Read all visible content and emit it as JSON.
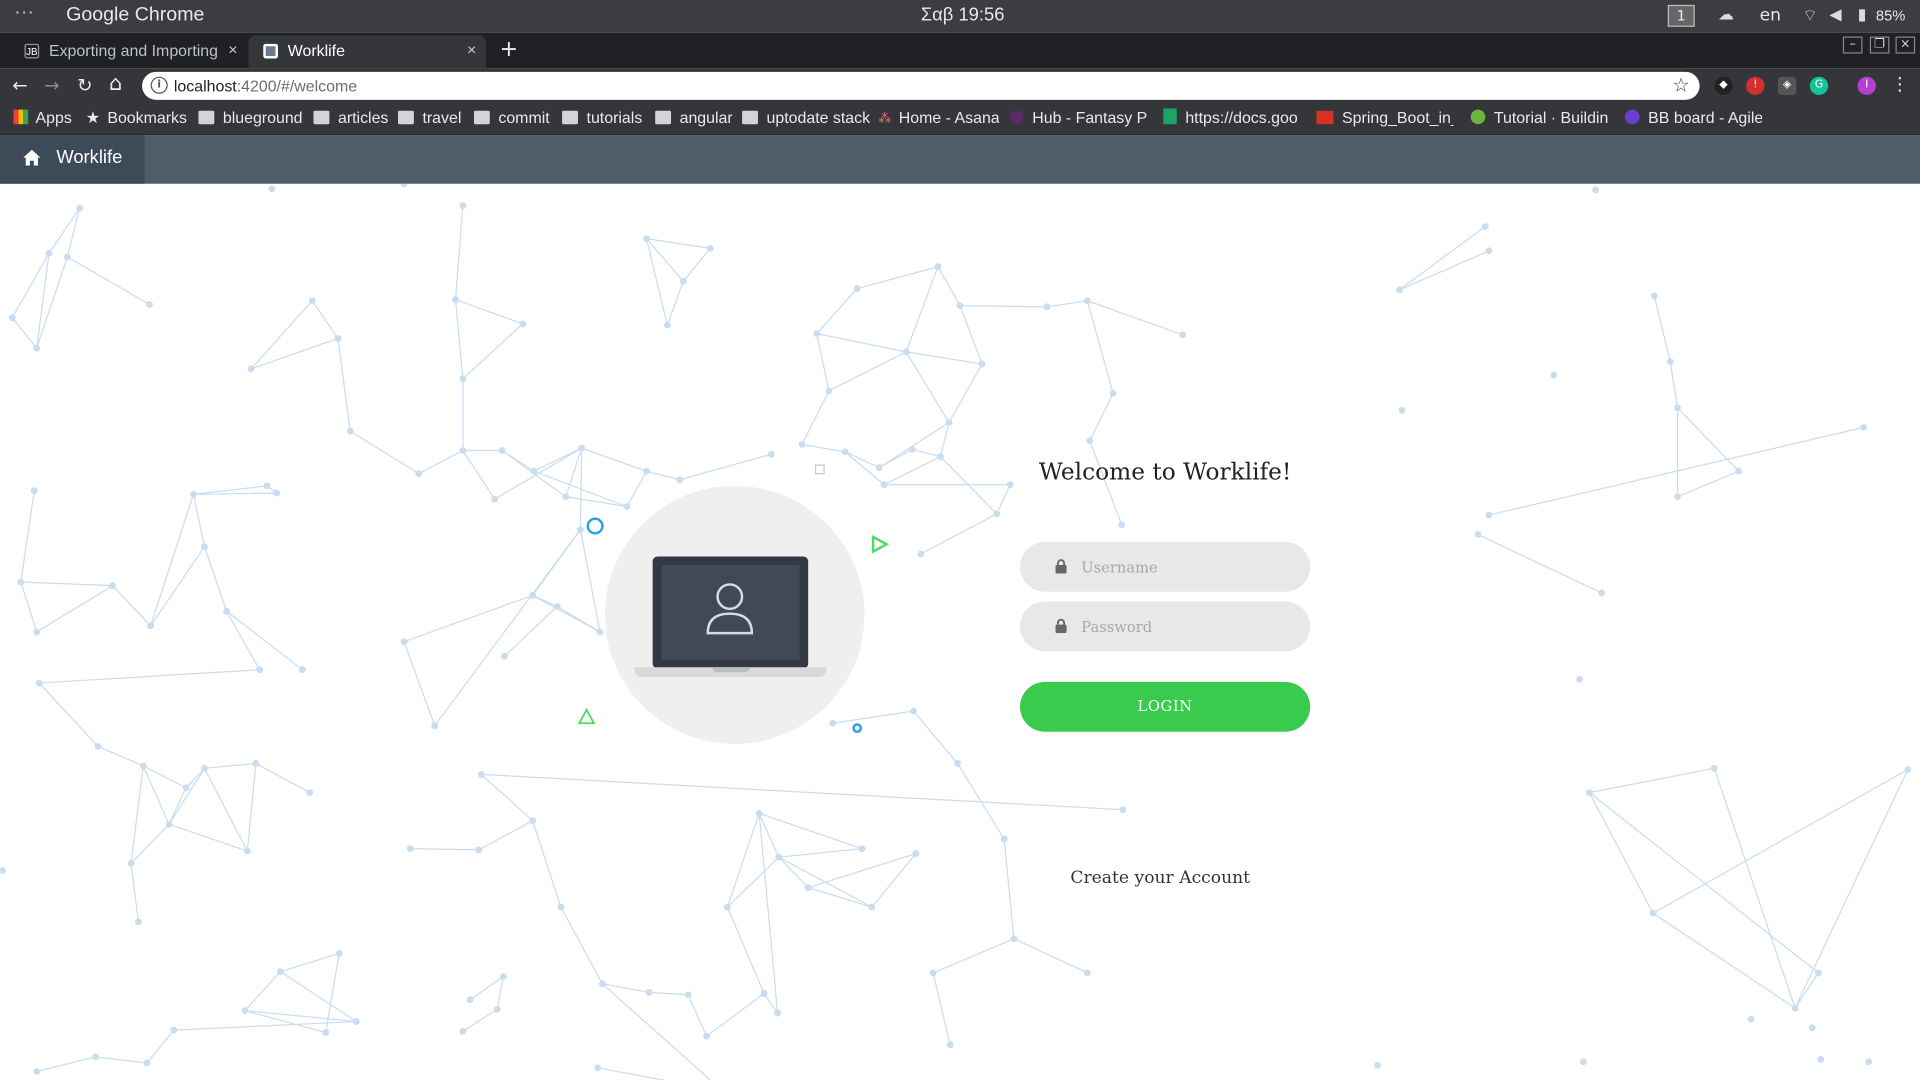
{
  "system_bar": {
    "menu_dots": "···",
    "app_name": "Google Chrome",
    "clock": "Σαβ 19:56",
    "workspace": "1",
    "language": "en",
    "battery": "85%"
  },
  "tabs": [
    {
      "title": "Exporting and Importing Se",
      "favicon": "JB",
      "active": false,
      "close": "×"
    },
    {
      "title": "Worklife",
      "favicon": "",
      "active": true,
      "close": "×"
    }
  ],
  "new_tab": "+",
  "toolbar": {
    "back": "←",
    "forward": "→",
    "reload": "↻",
    "home": "⌂",
    "url_host": "localhost",
    "url_path": ":4200/#/welcome",
    "bookmark_star": "☆"
  },
  "bookmarks": [
    {
      "label": "Apps",
      "icon": "apps-grid-icon"
    },
    {
      "label": "Bookmarks",
      "icon": "star-icon"
    },
    {
      "label": "blueground",
      "icon": "folder-icon"
    },
    {
      "label": "articles",
      "icon": "folder-icon"
    },
    {
      "label": "travel",
      "icon": "folder-icon"
    },
    {
      "label": "commit",
      "icon": "folder-icon"
    },
    {
      "label": "tutorials",
      "icon": "folder-icon"
    },
    {
      "label": "angular",
      "icon": "folder-icon"
    },
    {
      "label": "uptodate stack",
      "icon": "folder-icon"
    },
    {
      "label": "Home - Asana",
      "icon": "asana-icon"
    },
    {
      "label": "Hub - Fantasy Pre",
      "icon": "site-icon"
    },
    {
      "label": "https://docs.goo",
      "icon": "sheets-icon"
    },
    {
      "label": "Spring_Boot_in_",
      "icon": "pdf-icon"
    },
    {
      "label": "Tutorial · Building",
      "icon": "spring-icon"
    },
    {
      "label": "BB board - Agile",
      "icon": "site-icon"
    }
  ],
  "app": {
    "brand": "Worklife",
    "welcome": "Welcome to Worklife!",
    "username_placeholder": "Username",
    "password_placeholder": "Password",
    "login": "LOGIN",
    "create_account": "Create your Account"
  },
  "colors": {
    "navbar": "#4f5d6b",
    "brand_bg": "#3d4a57",
    "login_green": "#3acb4e",
    "network_line": "#c9ddef",
    "accent_blue": "#29a3dd"
  }
}
